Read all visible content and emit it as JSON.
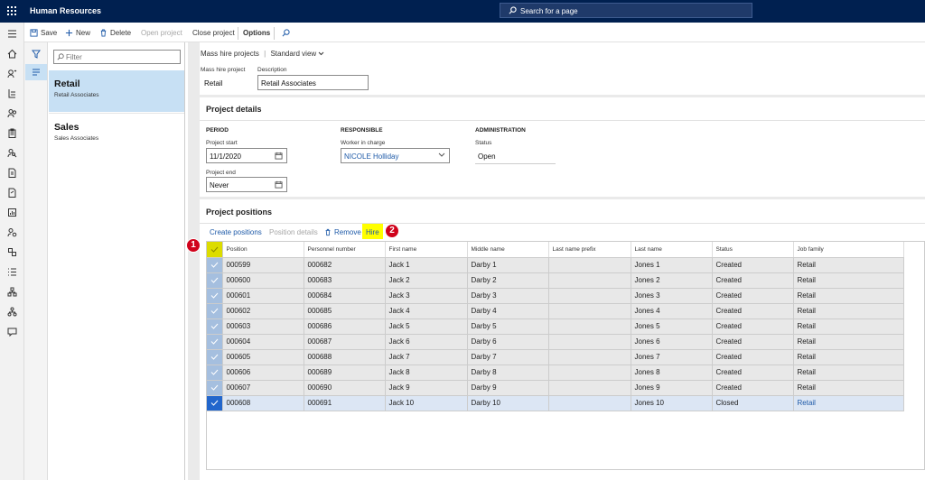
{
  "app": {
    "title": "Human Resources",
    "search_placeholder": "Search for a page"
  },
  "actions": {
    "save": "Save",
    "new": "New",
    "delete": "Delete",
    "open_project": "Open project",
    "close_project": "Close project",
    "options": "Options"
  },
  "list": {
    "filter_placeholder": "Filter",
    "items": [
      {
        "title": "Retail",
        "subtitle": "Retail Associates"
      },
      {
        "title": "Sales",
        "subtitle": "Sales Associates"
      }
    ]
  },
  "header": {
    "breadcrumb": "Mass hire projects",
    "view": "Standard view"
  },
  "fields": {
    "mass_hire_label": "Mass hire project",
    "mass_hire_value": "Retail",
    "description_label": "Description",
    "description_value": "Retail Associates"
  },
  "details": {
    "title": "Project details",
    "period": "PERIOD",
    "responsible": "RESPONSIBLE",
    "administration": "ADMINISTRATION",
    "start_label": "Project start",
    "start_value": "11/1/2020",
    "end_label": "Project end",
    "end_value": "Never",
    "worker_label": "Worker in charge",
    "worker_value": "NICOLE Holliday",
    "status_label": "Status",
    "status_value": "Open"
  },
  "positions": {
    "title": "Project positions",
    "create": "Create positions",
    "details": "Position details",
    "remove": "Remove",
    "hire": "Hire"
  },
  "badges": [
    "1",
    "2"
  ],
  "grid": {
    "columns": [
      "Position",
      "Personnel number",
      "First name",
      "Middle name",
      "Last name prefix",
      "Last name",
      "Status",
      "Job family"
    ],
    "rows": [
      [
        "000599",
        "000682",
        "Jack 1",
        "Darby 1",
        "",
        "Jones 1",
        "Created",
        "Retail"
      ],
      [
        "000600",
        "000683",
        "Jack 2",
        "Darby 2",
        "",
        "Jones 2",
        "Created",
        "Retail"
      ],
      [
        "000601",
        "000684",
        "Jack 3",
        "Darby 3",
        "",
        "Jones 3",
        "Created",
        "Retail"
      ],
      [
        "000602",
        "000685",
        "Jack 4",
        "Darby 4",
        "",
        "Jones 4",
        "Created",
        "Retail"
      ],
      [
        "000603",
        "000686",
        "Jack 5",
        "Darby 5",
        "",
        "Jones 5",
        "Created",
        "Retail"
      ],
      [
        "000604",
        "000687",
        "Jack 6",
        "Darby 6",
        "",
        "Jones 6",
        "Created",
        "Retail"
      ],
      [
        "000605",
        "000688",
        "Jack 7",
        "Darby 7",
        "",
        "Jones 7",
        "Created",
        "Retail"
      ],
      [
        "000606",
        "000689",
        "Jack 8",
        "Darby 8",
        "",
        "Jones 8",
        "Created",
        "Retail"
      ],
      [
        "000607",
        "000690",
        "Jack 9",
        "Darby 9",
        "",
        "Jones 9",
        "Created",
        "Retail"
      ],
      [
        "000608",
        "000691",
        "Jack 10",
        "Darby 10",
        "",
        "Jones 10",
        "Closed",
        "Retail"
      ]
    ]
  }
}
